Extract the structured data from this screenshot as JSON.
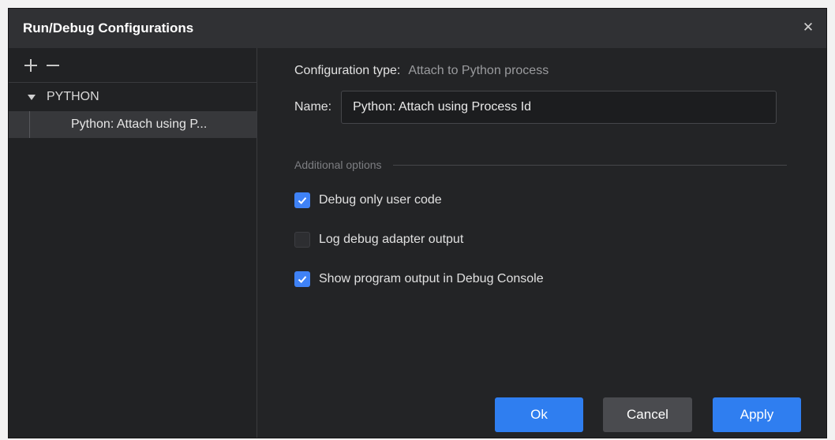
{
  "dialog": {
    "title": "Run/Debug Configurations",
    "close_icon": "close-icon"
  },
  "sidebar": {
    "add_icon": "plus-icon",
    "remove_icon": "minus-icon",
    "group_label": "PYTHON",
    "item_label": "Python: Attach using P..."
  },
  "config": {
    "type_label": "Configuration type:",
    "type_value": "Attach to Python process",
    "name_label": "Name:",
    "name_value": "Python: Attach using Process Id",
    "section_label": "Additional options"
  },
  "options": [
    {
      "label": "Debug only user code",
      "checked": true
    },
    {
      "label": "Log debug adapter output",
      "checked": false
    },
    {
      "label": "Show program output in Debug Console",
      "checked": true
    }
  ],
  "buttons": {
    "ok": "Ok",
    "cancel": "Cancel",
    "apply": "Apply"
  },
  "colors": {
    "accent": "#2f7ef0",
    "background": "#232426",
    "titlebar": "#303134"
  }
}
